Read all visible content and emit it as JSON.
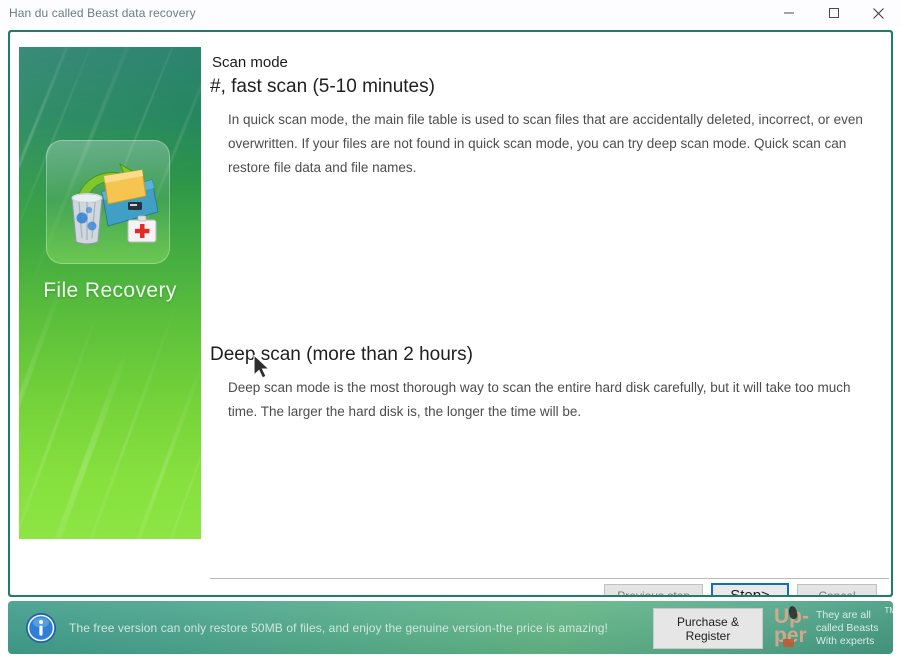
{
  "window": {
    "title": "Han du called Beast data recovery",
    "controls": {
      "minimize": "minimize-icon",
      "maximize": "maximize-icon",
      "close": "close-icon"
    }
  },
  "sidebar": {
    "label": "File Recovery",
    "icon": "file-recovery-icon"
  },
  "main": {
    "section_label": "Scan mode",
    "quick": {
      "heading": "#, fast scan (5-10 minutes)",
      "description": "In quick scan mode, the main file table is used to scan files that are accidentally deleted, incorrect, or even overwritten. If your files are not found in quick scan mode, you can try deep scan mode.  Quick scan can restore file data and file names."
    },
    "deep": {
      "heading": "Deep scan (more than 2 hours)",
      "description": "Deep scan mode is the most thorough way to scan the entire hard disk carefully, but it will take too much time. The larger the hard disk is, the longer the time will be."
    }
  },
  "footer_buttons": {
    "previous": "Previous step",
    "next": "Step>",
    "cancel": "Cancel"
  },
  "promo": {
    "icon": "info-icon",
    "message": "The free version can only restore 50MB of files, and enjoy the genuine version-the price is amazing!",
    "purchase_label": "Purchase & Register",
    "brand": {
      "word_line1": "Up-",
      "word_line2": "per",
      "tagline_line1": "They are all",
      "tagline_line2": "called Beasts",
      "tagline_line3": "With experts",
      "trademark": "TM"
    }
  },
  "colors": {
    "frame": "#1f7d68",
    "accent_blue": "#1070c0",
    "panel_top": "#14755f",
    "panel_bottom": "#8ce544",
    "promo_green": "#4aa58d"
  }
}
